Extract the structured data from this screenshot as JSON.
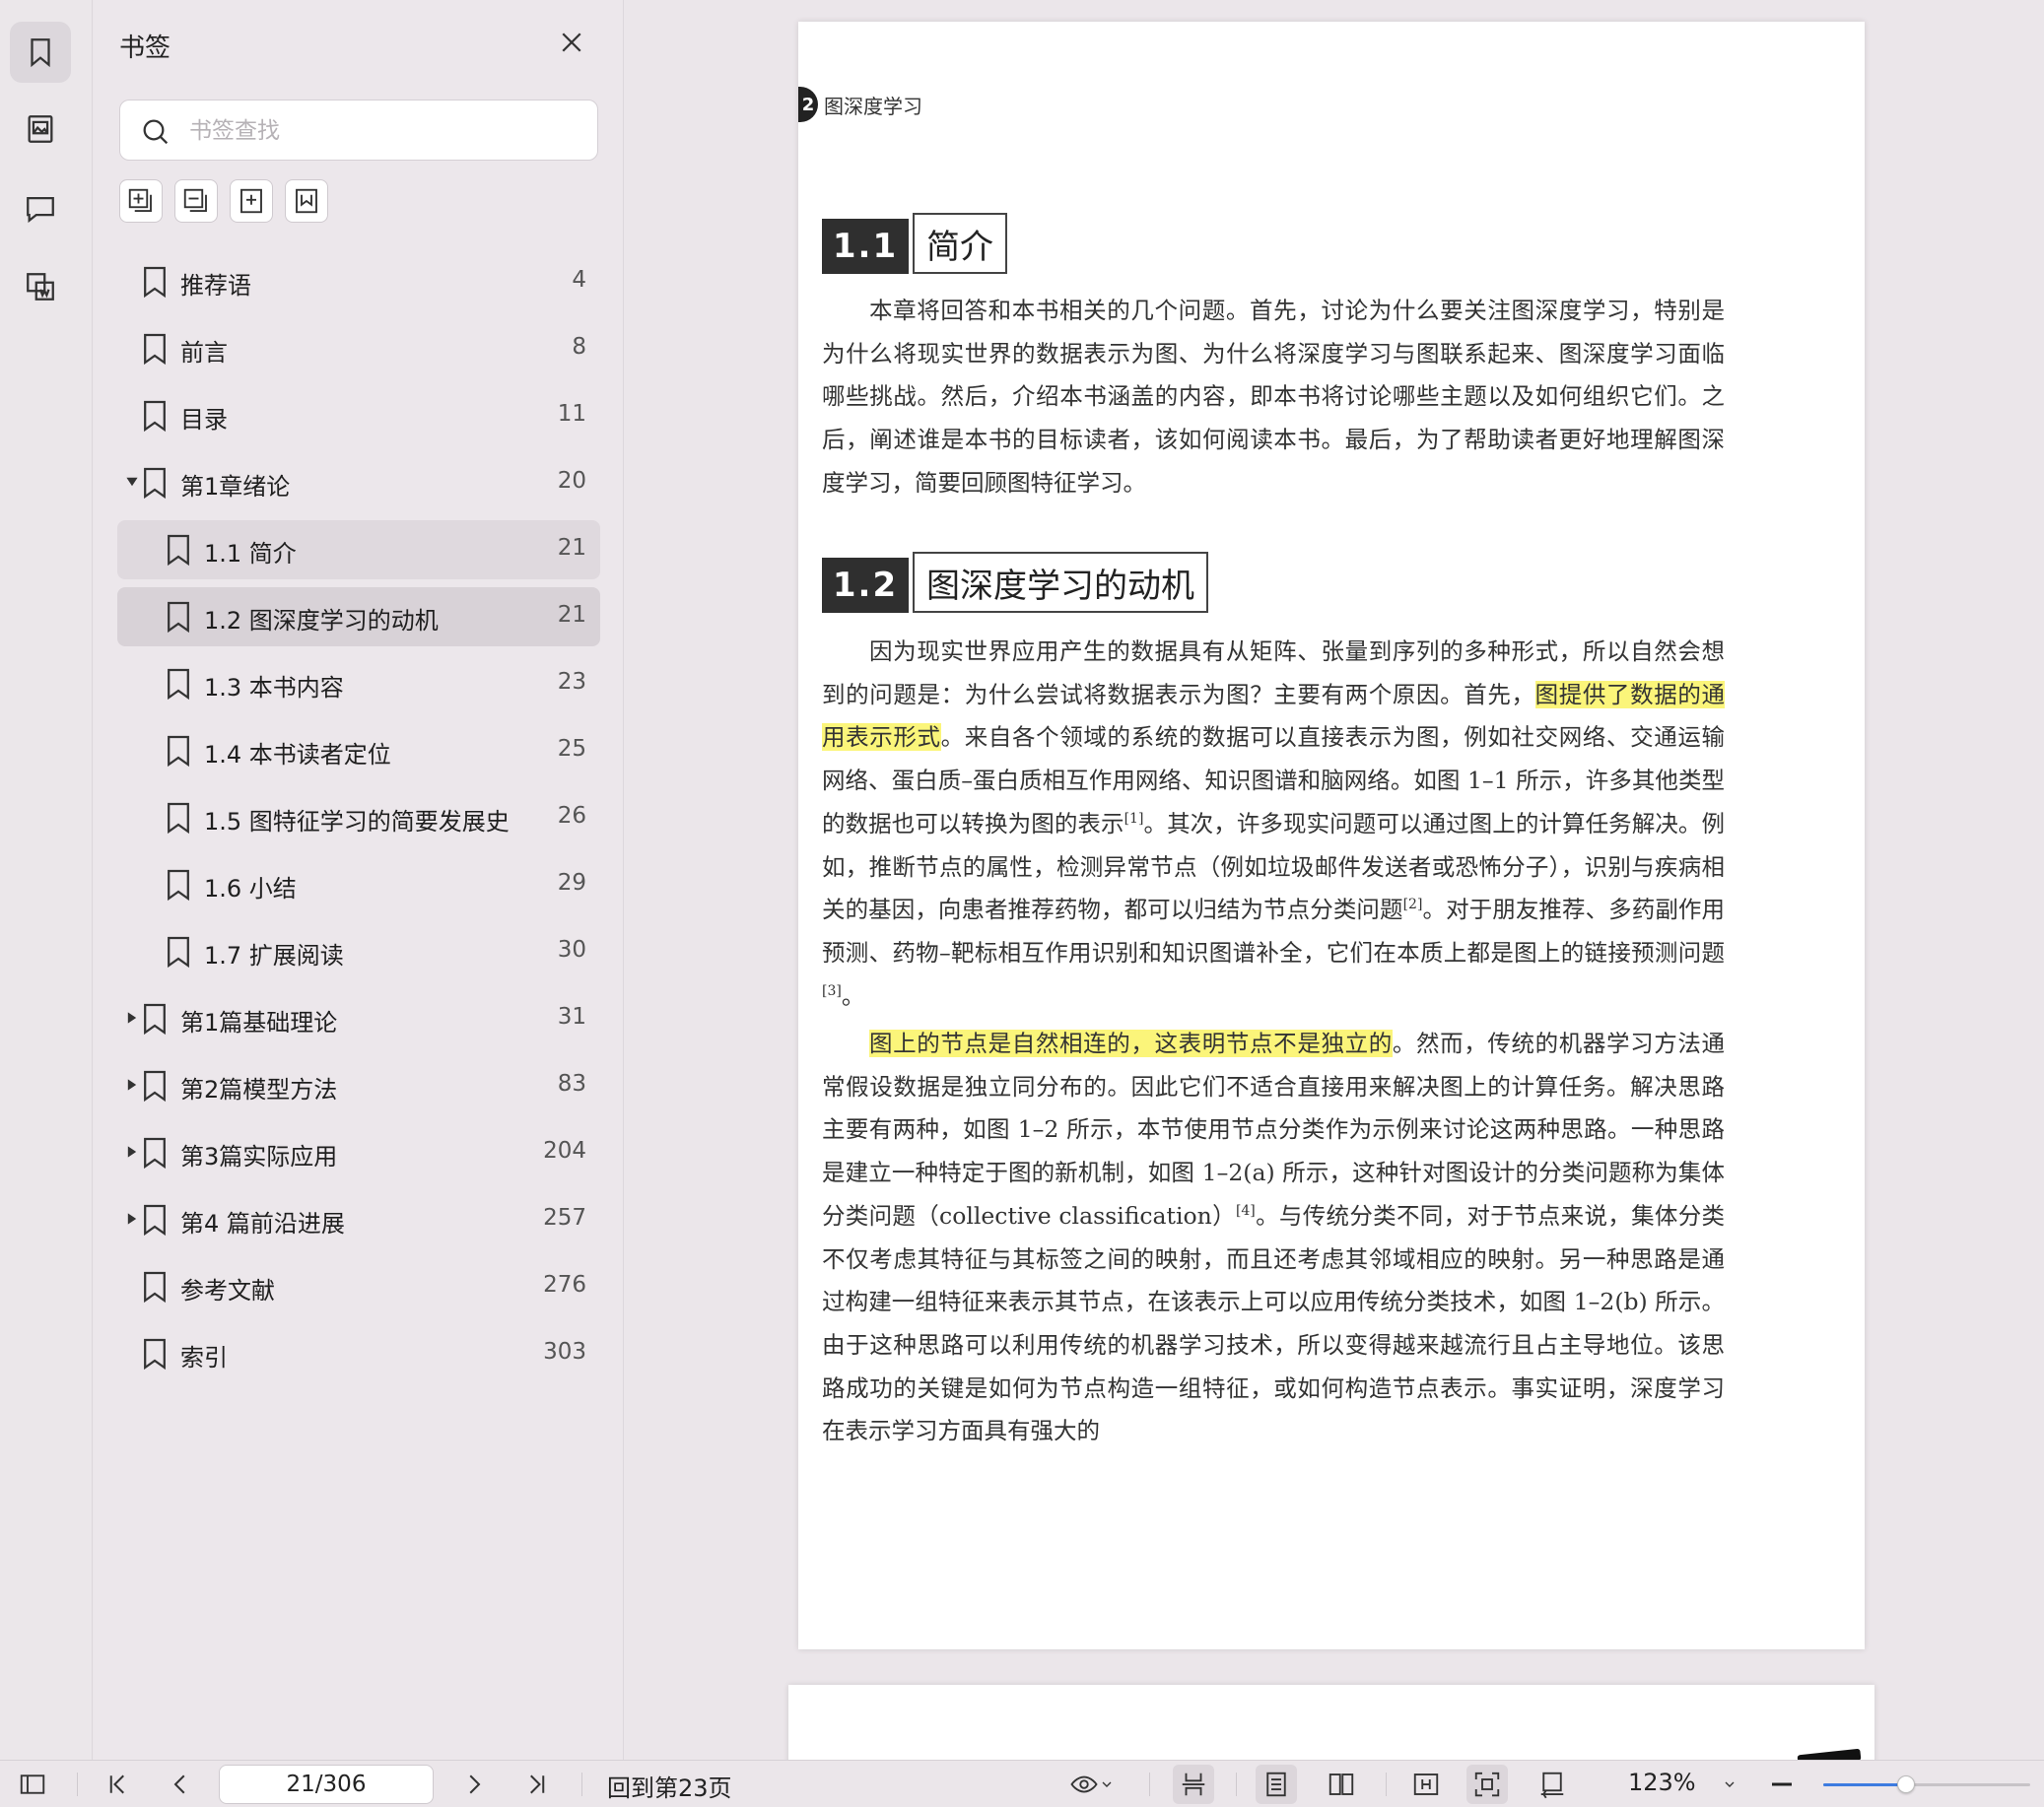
{
  "rail": {
    "items": [
      {
        "icon": "bookmark-icon",
        "active": true
      },
      {
        "icon": "thumbnail-icon",
        "active": false
      },
      {
        "icon": "comment-icon",
        "active": false
      },
      {
        "icon": "copy-icon",
        "active": false
      }
    ]
  },
  "panel": {
    "title": "书签",
    "search_placeholder": "书签查找",
    "bookmarks": [
      {
        "label": "推荐语",
        "page": "4",
        "level": 0,
        "caret": "none"
      },
      {
        "label": "前言",
        "page": "8",
        "level": 0,
        "caret": "none"
      },
      {
        "label": "目录",
        "page": "11",
        "level": 0,
        "caret": "none"
      },
      {
        "label": "第1章绪论",
        "page": "20",
        "level": 0,
        "caret": "down"
      },
      {
        "label": "1.1 简介",
        "page": "21",
        "level": 1,
        "caret": "none"
      },
      {
        "label": "1.2 图深度学习的动机",
        "page": "21",
        "level": 1,
        "caret": "none"
      },
      {
        "label": "1.3 本书内容",
        "page": "23",
        "level": 1,
        "caret": "none"
      },
      {
        "label": "1.4 本书读者定位",
        "page": "25",
        "level": 1,
        "caret": "none"
      },
      {
        "label": "1.5 图特征学习的简要发展史",
        "page": "26",
        "level": 1,
        "caret": "none"
      },
      {
        "label": "1.6 小结",
        "page": "29",
        "level": 1,
        "caret": "none"
      },
      {
        "label": "1.7 扩展阅读",
        "page": "30",
        "level": 1,
        "caret": "none"
      },
      {
        "label": "第1篇基础理论",
        "page": "31",
        "level": 0,
        "caret": "right"
      },
      {
        "label": "第2篇模型方法",
        "page": "83",
        "level": 0,
        "caret": "right"
      },
      {
        "label": "第3篇实际应用",
        "page": "204",
        "level": 0,
        "caret": "right"
      },
      {
        "label": "第4 篇前沿进展",
        "page": "257",
        "level": 0,
        "caret": "right"
      },
      {
        "label": "参考文献",
        "page": "276",
        "level": 0,
        "caret": "none"
      },
      {
        "label": "索引",
        "page": "303",
        "level": 0,
        "caret": "none"
      }
    ]
  },
  "document": {
    "running_head_num": "2",
    "running_head": "图深度学习",
    "sec1_num": "1.1",
    "sec1_title": "简介",
    "sec1_para": "本章将回答和本书相关的几个问题。首先，讨论为什么要关注图深度学习，特别是为什么将现实世界的数据表示为图、为什么将深度学习与图联系起来、图深度学习面临哪些挑战。然后，介绍本书涵盖的内容，即本书将讨论哪些主题以及如何组织它们。之后，阐述谁是本书的目标读者，该如何阅读本书。最后，为了帮助读者更好地理解图深度学习，简要回顾图特征学习。",
    "sec2_num": "1.2",
    "sec2_title": "图深度学习的动机",
    "p2_a": "因为现实世界应用产生的数据具有从矩阵、张量到序列的多种形式，所以自然会想到的问题是：为什么尝试将数据表示为图？主要有两个原因。首先，",
    "p2_hl": "图提供了数据的通用表示形式",
    "p2_b": "。来自各个领域的系统的数据可以直接表示为图，例如社交网络、交通运输网络、蛋白质–蛋白质相互作用网络、知识图谱和脑网络。如图 1–1 所示，许多其他类型的数据也可以转换为图的表示",
    "p2_ref1": "[1]",
    "p2_c": "。其次，许多现实问题可以通过图上的计算任务解决。例如，推断节点的属性，检测异常节点（例如垃圾邮件发送者或恐怖分子），识别与疾病相关的基因，向患者推荐药物，都可以归结为节点分类问题",
    "p2_ref2": "[2]",
    "p2_d": "。对于朋友推荐、多药副作用预测、药物–靶标相互作用识别和知识图谱补全，它们在本质上都是图上的链接预测问题",
    "p2_ref3": "[3]",
    "p2_e": "。",
    "p3_hl": "图上的节点是自然相连的，这表明节点不是独立的",
    "p3_a": "。然而，传统的机器学习方法通常假设数据是独立同分布的。因此它们不适合直接用来解决图上的计算任务。解决思路主要有两种，如图 1–2 所示，本节使用节点分类作为示例来讨论这两种思路。一种思路是建立一种特定于图的新机制，如图 1–2(a) 所示，这种针对图设计的分类问题称为集体分类问题（collective classification）",
    "p3_ref4": "[4]",
    "p3_b": "。与传统分类不同，对于节点来说，集体分类不仅考虑其特征与其标签之间的映射，而且还考虑其邻域相应的映射。另一种思路是通过构建一组特征来表示其节点，在该表示上可以应用传统分类技术，如图 1–2(b) 所示。由于这种思路可以利用传统的机器学习技术，所以变得越来越流行且占主导地位。该思路成功的关键是如何为节点构造一组特征，或如何构造节点表示。事实证明，深度学习在表示学习方面具有强大的"
  },
  "bottombar": {
    "page_indicator": "21/306",
    "goto_label": "回到第23页",
    "zoom": "123%",
    "zoom_slider_value": 0.4
  },
  "colors": {
    "highlight": "#fbf57a",
    "accent": "#3d7be0"
  }
}
